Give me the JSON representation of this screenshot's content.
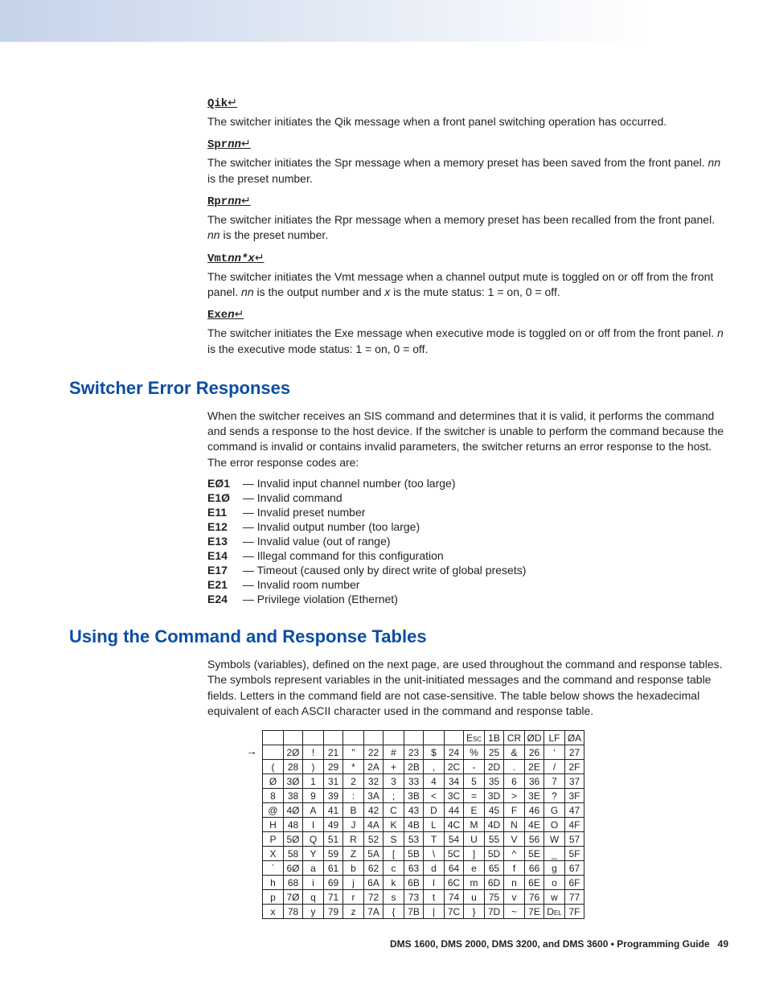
{
  "messages": {
    "qik": {
      "cmd": "Qik",
      "suffix": "",
      "enter": "↵",
      "text": "The switcher initiates the Qik message when a front panel switching operation has occurred."
    },
    "spr": {
      "cmd": "Spr",
      "suffix": "nn",
      "enter": "↵",
      "text1": "The switcher initiates the Spr message when a memory preset has been saved from the front panel. ",
      "ital": "nn",
      "text2": " is the preset number."
    },
    "rpr": {
      "cmd": "Rpr",
      "suffix": "nn",
      "enter": "↵",
      "text1": "The switcher initiates the Rpr message when a memory preset has been recalled from the front panel. ",
      "ital": "nn",
      "text2": " is the preset number."
    },
    "vmt": {
      "cmd": "Vmt",
      "suffix": "nn*x",
      "enter": "↵",
      "text1": "The switcher initiates the Vmt message when a channel output mute is toggled on or off from the front panel. ",
      "ital1": "nn",
      "text2": " is the output number and ",
      "ital2": "x",
      "text3": " is the mute status: 1 = on, 0 = off."
    },
    "exe": {
      "cmd": "Exe",
      "suffix": "n",
      "enter": "↵",
      "text1": "The switcher initiates the Exe message when executive mode is toggled on or off from the front panel. ",
      "ital": "n",
      "text2": " is the executive mode status: 1 = on, 0 = off."
    }
  },
  "sections": {
    "error_heading": "Switcher Error Responses",
    "error_intro": "When the switcher receives an SIS command and determines that it is valid, it performs the command and sends a response to the host device. If the switcher is unable to perform the command because the command is invalid or contains invalid parameters, the switcher returns an error response to the host. The error response codes are:",
    "tables_heading": "Using the Command and Response Tables",
    "tables_intro": "Symbols (variables), defined on the next page, are used throughout the command and response tables. The symbols represent variables in the unit-initiated messages and the command and response table fields. Letters in the command field are not case-sensitive. The table below shows the hexadecimal equivalent of each ASCII character used in the command and response table."
  },
  "errors": [
    {
      "code": "E01",
      "display": "EØ1",
      "desc": " — Invalid input channel number (too large)"
    },
    {
      "code": "E10",
      "display": "E1Ø",
      "desc": " — Invalid command"
    },
    {
      "code": "E11",
      "display": "E11",
      "desc": " — Invalid preset number"
    },
    {
      "code": "E12",
      "display": "E12",
      "desc": " — Invalid output number (too large)"
    },
    {
      "code": "E13",
      "display": "E13",
      "desc": " — Invalid value (out of range)"
    },
    {
      "code": "E14",
      "display": "E14",
      "desc": " — Illegal command for this configuration"
    },
    {
      "code": "E17",
      "display": "E17",
      "desc": " — Timeout (caused only by direct write of global presets)"
    },
    {
      "code": "E21",
      "display": "E21",
      "desc": " — Invalid room number"
    },
    {
      "code": "E24",
      "display": "E24",
      "desc": " — Privilege violation (Ethernet)"
    }
  ],
  "ascii_header": [
    "",
    "",
    "",
    "",
    "",
    "",
    "",
    "",
    "",
    "",
    "Esc",
    "1B",
    "CR",
    "ØD",
    "LF",
    "ØA"
  ],
  "ascii_rows": [
    [
      "",
      "2Ø",
      "!",
      "21",
      "\"",
      "22",
      "#",
      "23",
      "$",
      "24",
      "%",
      "25",
      "&",
      "26",
      "‘",
      "27"
    ],
    [
      "(",
      "28",
      ")",
      "29",
      "*",
      "2A",
      "+",
      "2B",
      ",",
      "2C",
      "-",
      "2D",
      ".",
      "2E",
      "/",
      "2F"
    ],
    [
      "Ø",
      "3Ø",
      "1",
      "31",
      "2",
      "32",
      "3",
      "33",
      "4",
      "34",
      "5",
      "35",
      "6",
      "36",
      "7",
      "37"
    ],
    [
      "8",
      "38",
      "9",
      "39",
      ":",
      "3A",
      ";",
      "3B",
      "<",
      "3C",
      "=",
      "3D",
      ">",
      "3E",
      "?",
      "3F"
    ],
    [
      "@",
      "4Ø",
      "A",
      "41",
      "B",
      "42",
      "C",
      "43",
      "D",
      "44",
      "E",
      "45",
      "F",
      "46",
      "G",
      "47"
    ],
    [
      "H",
      "48",
      "I",
      "49",
      "J",
      "4A",
      "K",
      "4B",
      "L",
      "4C",
      "M",
      "4D",
      "N",
      "4E",
      "O",
      "4F"
    ],
    [
      "P",
      "5Ø",
      "Q",
      "51",
      "R",
      "52",
      "S",
      "53",
      "T",
      "54",
      "U",
      "55",
      "V",
      "56",
      "W",
      "57"
    ],
    [
      "X",
      "58",
      "Y",
      "59",
      "Z",
      "5A",
      "[",
      "5B",
      "\\",
      "5C",
      "]",
      "5D",
      "^",
      "5E",
      "_",
      "5F"
    ],
    [
      "`",
      "6Ø",
      "a",
      "61",
      "b",
      "62",
      "c",
      "63",
      "d",
      "64",
      "e",
      "65",
      "f",
      "66",
      "g",
      "67"
    ],
    [
      "h",
      "68",
      "i",
      "69",
      "j",
      "6A",
      "k",
      "6B",
      "l",
      "6C",
      "m",
      "6D",
      "n",
      "6E",
      "o",
      "6F"
    ],
    [
      "p",
      "7Ø",
      "q",
      "71",
      "r",
      "72",
      "s",
      "73",
      "t",
      "74",
      "u",
      "75",
      "v",
      "76",
      "w",
      "77"
    ],
    [
      "x",
      "78",
      "y",
      "79",
      "z",
      "7A",
      "{",
      "7B",
      "|",
      "7C",
      "}",
      "7D",
      "~",
      "7E",
      "Del",
      "7F"
    ]
  ],
  "footer": {
    "bold": "DMS 1600, DMS 2000, DMS 3200, and DMS 3600 • Programming Guide",
    "page": "49"
  }
}
